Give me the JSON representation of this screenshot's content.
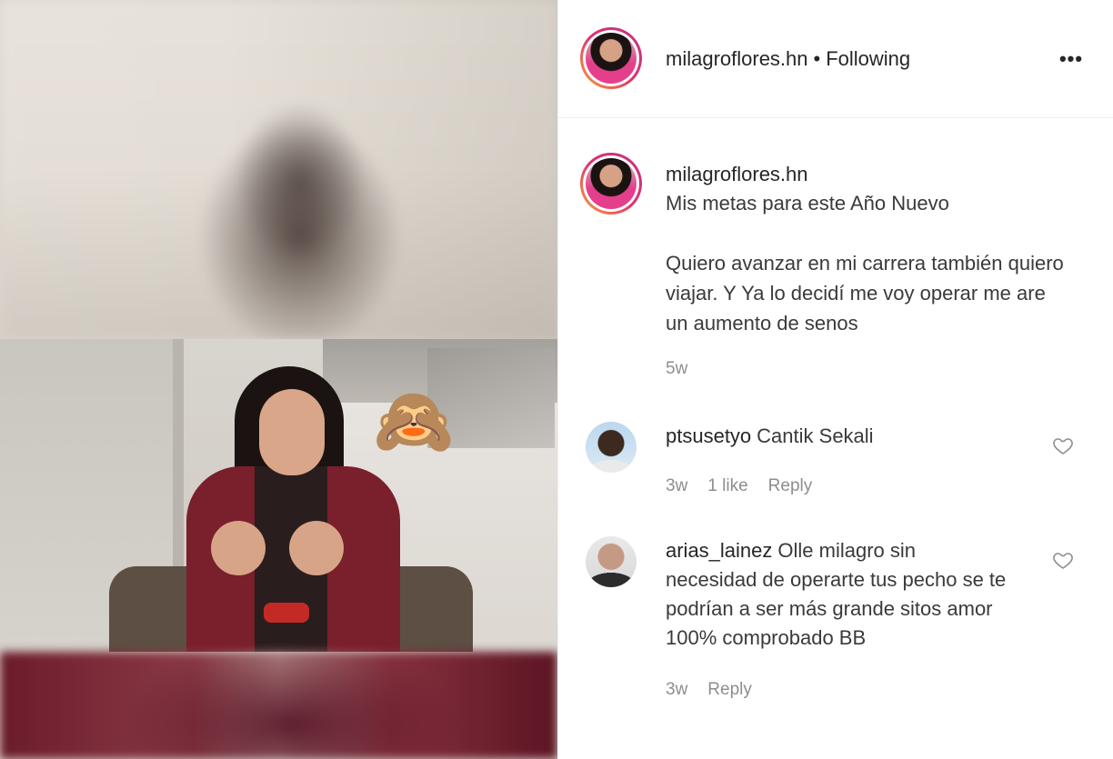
{
  "post": {
    "emoji": "🙈",
    "header": {
      "username": "milagroflores.hn",
      "separator": "•",
      "follow_status": "Following",
      "more_label": "•••"
    },
    "caption": {
      "username": "milagroflores.hn",
      "line1": "Mis metas para este Año Nuevo",
      "line2": "Quiero avanzar en mi carrera también quiero viajar. Y Ya lo decidí me voy operar me are un aumento de senos",
      "time": "5w"
    },
    "comments": [
      {
        "username": "ptsusetyo",
        "text": "Cantik Sekali",
        "time": "3w",
        "likes": "1 like",
        "reply": "Reply"
      },
      {
        "username": "arias_lainez",
        "text": "Olle milagro sin necesidad de operarte tus pecho se te podrían a ser más grande sitos amor 100% comprobado BB",
        "time": "3w",
        "reply": "Reply"
      }
    ]
  }
}
